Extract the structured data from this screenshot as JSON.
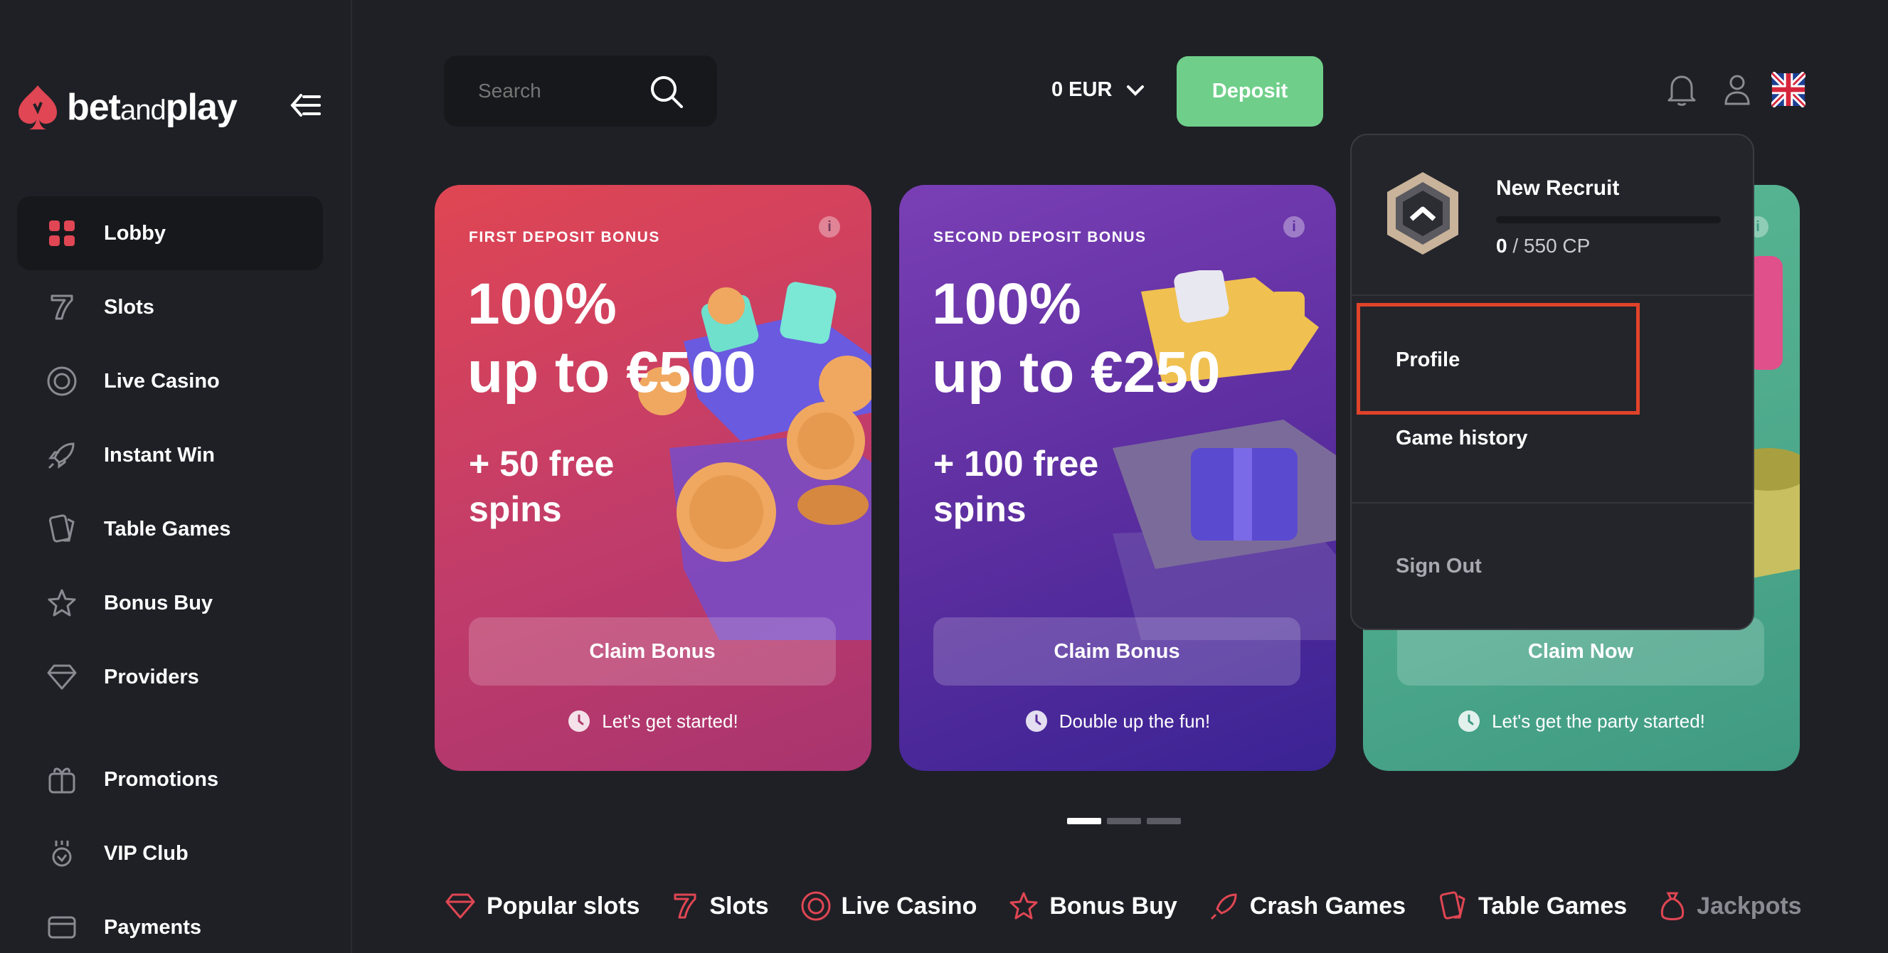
{
  "brand": {
    "name_bold": "bet",
    "name_thin": "and",
    "name_end": "play"
  },
  "sidebar": {
    "items": [
      {
        "label": "Lobby",
        "icon": "grid-icon",
        "active": true
      },
      {
        "label": "Slots",
        "icon": "seven-icon"
      },
      {
        "label": "Live Casino",
        "icon": "chip-icon"
      },
      {
        "label": "Instant Win",
        "icon": "rocket-icon"
      },
      {
        "label": "Table Games",
        "icon": "cards-icon"
      },
      {
        "label": "Bonus Buy",
        "icon": "star-icon"
      },
      {
        "label": "Providers",
        "icon": "diamond-icon"
      }
    ],
    "items2": [
      {
        "label": "Promotions",
        "icon": "gift-icon"
      },
      {
        "label": "VIP Club",
        "icon": "vip-icon"
      },
      {
        "label": "Payments",
        "icon": "card-icon"
      }
    ]
  },
  "header": {
    "search_placeholder": "Search",
    "balance": "0 EUR",
    "deposit_label": "Deposit",
    "colors": {
      "deposit": "#6fcf8a",
      "accent_red": "#e04653"
    }
  },
  "cards": [
    {
      "kicker": "FIRST DEPOSIT BONUS",
      "line1": "100%",
      "line2": "up to €500",
      "sub1": "+ 50 free",
      "sub2": "spins",
      "button": "Claim Bonus",
      "tagline": "Let's get started!"
    },
    {
      "kicker": "SECOND DEPOSIT BONUS",
      "line1": "100%",
      "line2": "up to €250",
      "sub1": "+ 100 free",
      "sub2": "spins",
      "button": "Claim Bonus",
      "tagline": "Double up the fun!"
    },
    {
      "kicker": "",
      "line1": "",
      "line2": "",
      "sub1": "",
      "sub2": "",
      "button": "Claim Now",
      "tagline": "Let's get the party started!"
    }
  ],
  "carousel": {
    "pages": 3,
    "current": 1
  },
  "categories": [
    "Popular slots",
    "Slots",
    "Live Casino",
    "Bonus Buy",
    "Crash Games",
    "Table Games",
    "Jackpots"
  ],
  "user_menu": {
    "rank_name": "New Recruit",
    "points": "0",
    "points_total": "/ 550 CP",
    "progress": 0,
    "items": [
      "Profile",
      "Game history"
    ],
    "signout": "Sign Out"
  }
}
